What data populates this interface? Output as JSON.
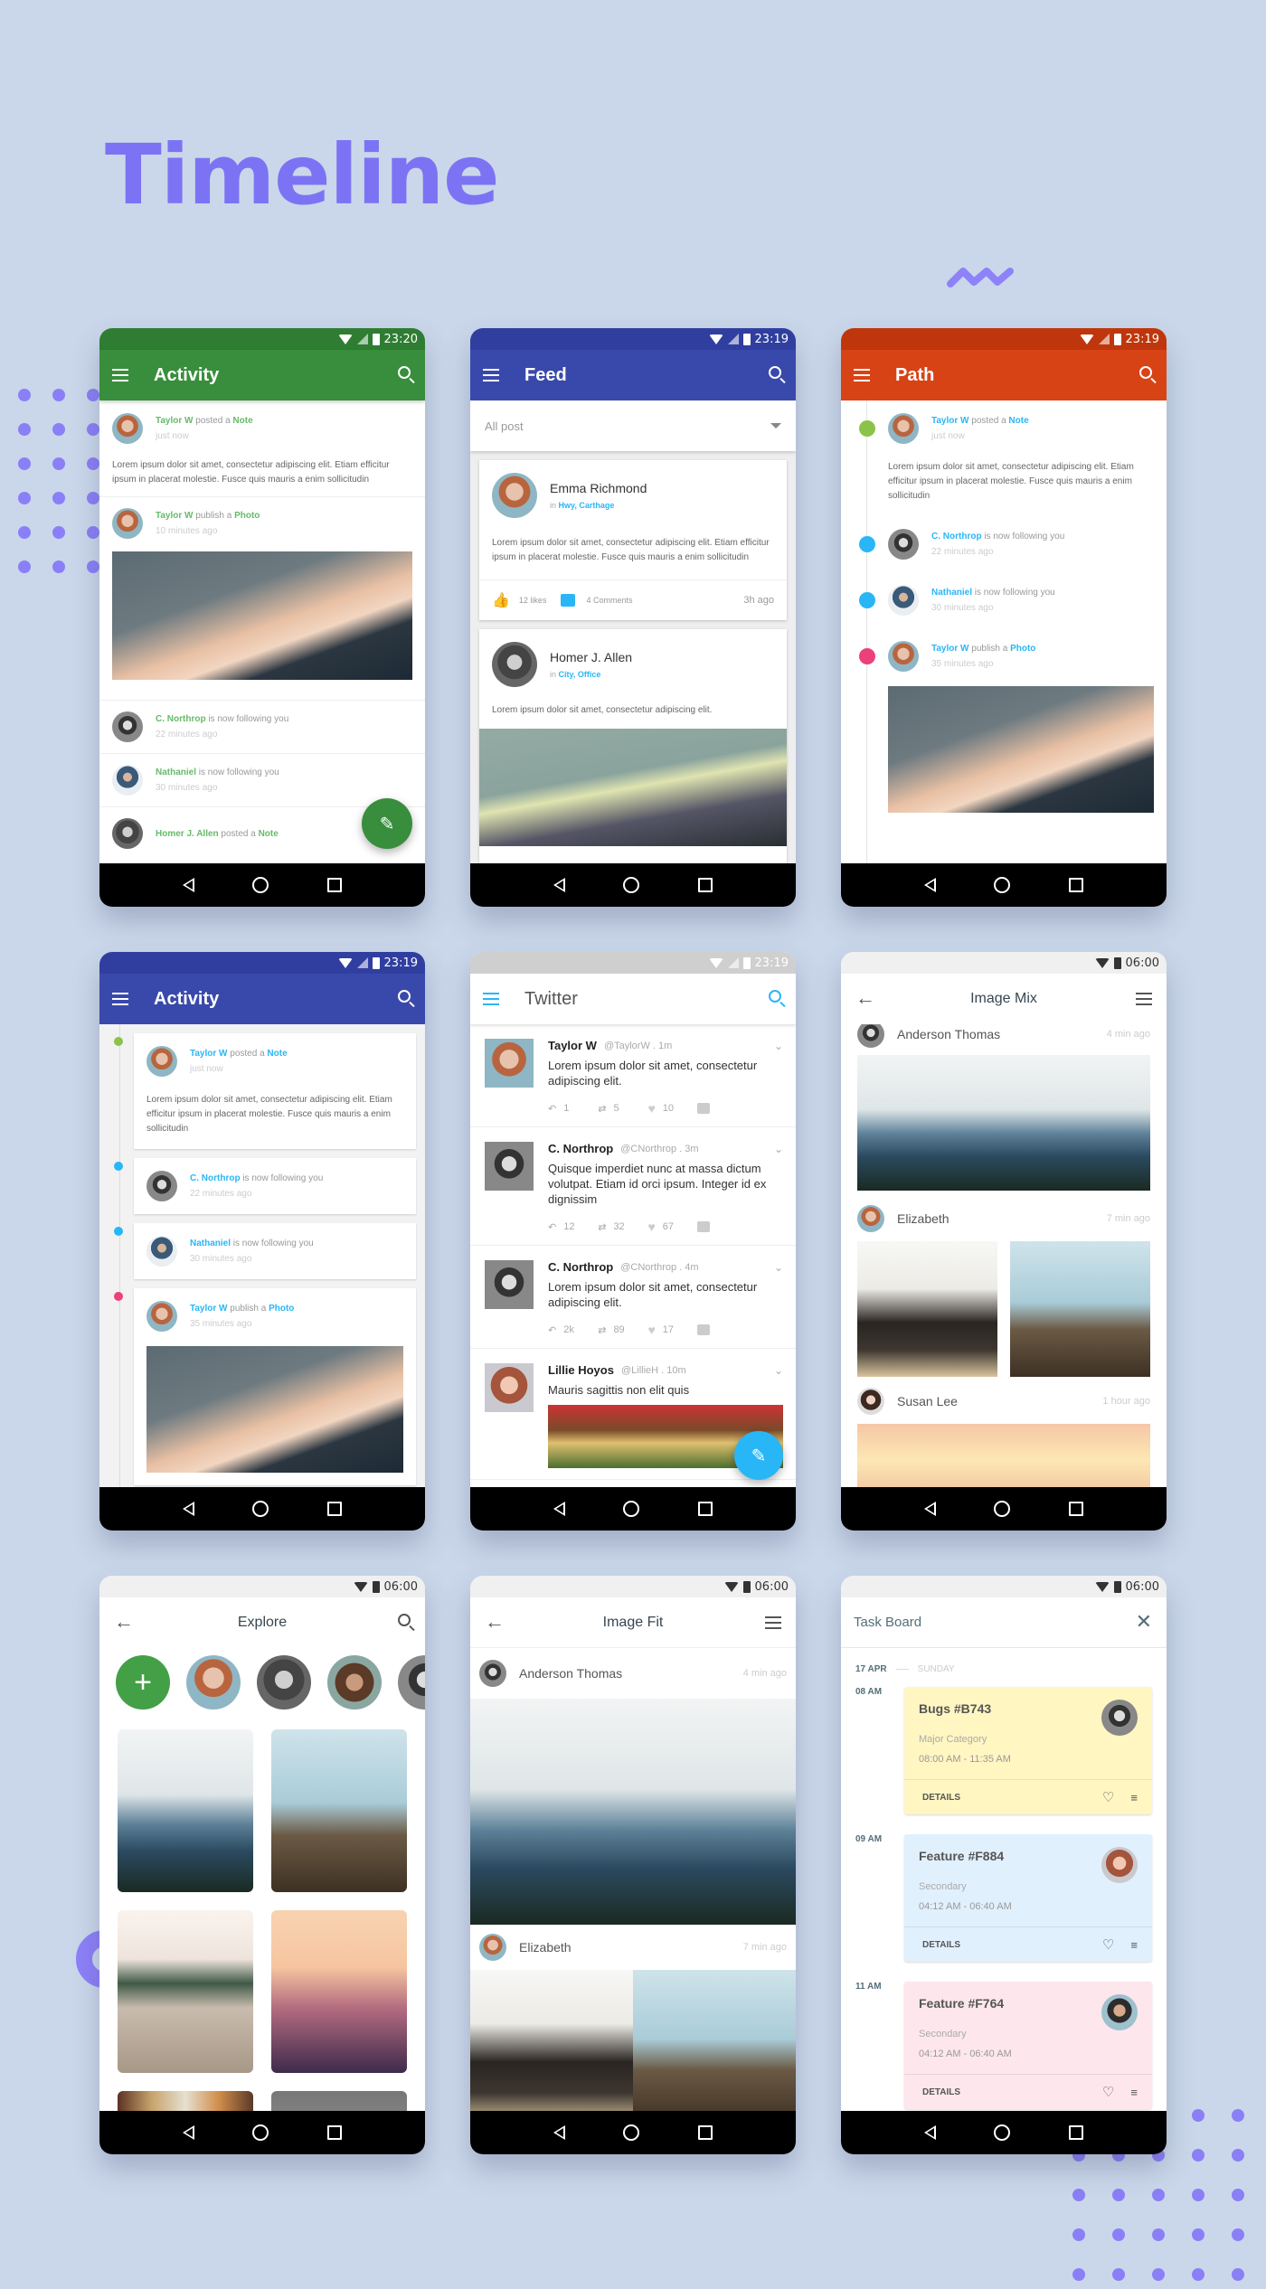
{
  "page_title": "Timeline",
  "colors": {
    "accent": "#7c73f4",
    "green": "#388e3c",
    "indigo": "#3949ab",
    "orange": "#d84315",
    "blue": "#29b6f6"
  },
  "lorem_long": "Lorem ipsum dolor sit amet, consectetur adipiscing elit. Etiam efficitur ipsum in placerat molestie. Fusce quis mauris a enim sollicitudin",
  "lorem_short": "Lorem ipsum dolor sit amet, consectetur adipiscing elit.",
  "phones": {
    "activity_green": {
      "time": "23:20",
      "title": "Activity",
      "items": [
        {
          "actor": "Taylor W",
          "verb": " posted a ",
          "object": "Note",
          "time": "just now"
        },
        {
          "actor": "Taylor W",
          "verb": " publish a ",
          "object": "Photo",
          "time": "10 minutes ago"
        },
        {
          "actor": "C. Northrop",
          "verb": " is now following you",
          "object": "",
          "time": "22 minutes ago"
        },
        {
          "actor": "Nathaniel",
          "verb": " is now following you",
          "object": "",
          "time": "30 minutes ago"
        },
        {
          "actor": "Homer J. Allen",
          "verb": " posted a ",
          "object": "Note",
          "time": ""
        }
      ],
      "fab_icon": "pencil-icon"
    },
    "feed": {
      "time": "23:19",
      "title": "Feed",
      "filter": "All post",
      "cards": [
        {
          "name": "Emma Richmond",
          "in": "in ",
          "place": "Hwy, Carthage",
          "likes": "12 likes",
          "comments": "4 Comments",
          "ago": "3h ago"
        },
        {
          "name": "Homer J. Allen",
          "in": "in ",
          "place": "City, Office"
        }
      ]
    },
    "path": {
      "time": "23:19",
      "title": "Path",
      "items": [
        {
          "actor": "Taylor W",
          "verb": " posted a ",
          "object": "Note",
          "time": "just now"
        },
        {
          "actor": "C. Northrop",
          "verb": " is now following you",
          "object": "",
          "time": "22 minutes ago"
        },
        {
          "actor": "Nathaniel",
          "verb": " is now following you",
          "object": "",
          "time": "30 minutes ago"
        },
        {
          "actor": "Taylor W",
          "verb": " publish a ",
          "object": "Photo",
          "time": "35 minutes ago"
        }
      ]
    },
    "activity_indigo": {
      "time": "23:19",
      "title": "Activity",
      "items": [
        {
          "actor": "Taylor W",
          "verb": " posted a ",
          "object": "Note",
          "time": "just now"
        },
        {
          "actor": "C. Northrop",
          "verb": " is now following you",
          "object": "",
          "time": "22 minutes ago"
        },
        {
          "actor": "Nathaniel",
          "verb": " is now following you",
          "object": "",
          "time": "30 minutes ago"
        },
        {
          "actor": "Taylor W",
          "verb": " publish a ",
          "object": "Photo",
          "time": "35 minutes ago"
        }
      ]
    },
    "twitter": {
      "time": "23:19",
      "title": "Twitter",
      "tweets": [
        {
          "name": "Taylor W",
          "handle": "@TaylorW . 1m",
          "text": "Lorem ipsum dolor sit amet, consectetur adipiscing elit.",
          "replies": "1",
          "retweets": "5",
          "likes": "10"
        },
        {
          "name": "C. Northrop",
          "handle": "@CNorthrop . 3m",
          "text": "Quisque imperdiet nunc at massa dictum volutpat. Etiam id orci ipsum. Integer id ex dignissim",
          "replies": "12",
          "retweets": "32",
          "likes": "67"
        },
        {
          "name": "C. Northrop",
          "handle": "@CNorthrop . 4m",
          "text": "Lorem ipsum dolor sit amet, consectetur adipiscing elit.",
          "replies": "2k",
          "retweets": "89",
          "likes": "17"
        },
        {
          "name": "Lillie Hoyos",
          "handle": "@LillieH . 10m",
          "text": "Mauris sagittis non elit quis"
        }
      ]
    },
    "image_mix": {
      "time": "06:00",
      "title": "Image Mix",
      "posts": [
        {
          "name": "Anderson Thomas",
          "ago": "4 min ago"
        },
        {
          "name": "Elizabeth",
          "ago": "7 min ago"
        },
        {
          "name": "Susan Lee",
          "ago": "1 hour ago"
        }
      ]
    },
    "explore": {
      "time": "06:00",
      "title": "Explore",
      "add_label": "+"
    },
    "image_fit": {
      "time": "06:00",
      "title": "Image Fit",
      "posts": [
        {
          "name": "Anderson Thomas",
          "ago": "4 min ago"
        },
        {
          "name": "Elizabeth",
          "ago": "7 min ago"
        }
      ]
    },
    "task_board": {
      "time": "06:00",
      "title": "Task Board",
      "date": "17 APR",
      "day": "SUNDAY",
      "tasks": [
        {
          "hour": "08 AM",
          "title": "Bugs #B743",
          "category": "Major Category",
          "range": "08:00 AM - 11:35 AM",
          "action": "DETAILS",
          "color": "#fff6c2"
        },
        {
          "hour": "09 AM",
          "title": "Feature #F884",
          "category": "Secondary",
          "range": "04:12 AM - 06:40 AM",
          "action": "DETAILS",
          "color": "#e1f0fd"
        },
        {
          "hour": "11 AM",
          "title": "Feature #F764",
          "category": "Secondary",
          "range": "04:12 AM - 06:40 AM",
          "action": "DETAILS",
          "color": "#fde7ec"
        }
      ]
    }
  }
}
